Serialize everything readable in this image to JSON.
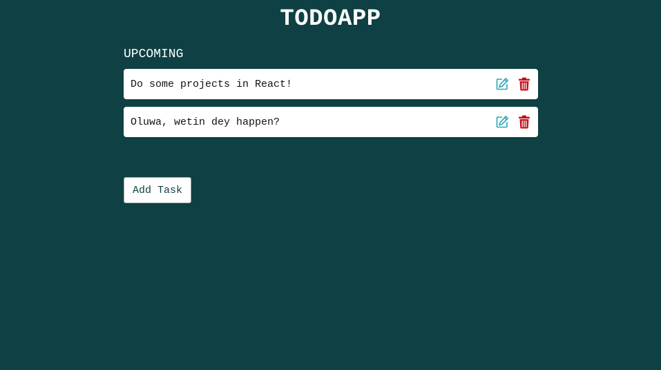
{
  "app": {
    "title": "TODOAPP"
  },
  "section": {
    "heading": "UPCOMING"
  },
  "tasks": [
    {
      "text": "Do some projects in React!",
      "edit_icon": "edit-icon",
      "delete_icon": "trash-icon"
    },
    {
      "text": "Oluwa, wetin dey happen?",
      "edit_icon": "edit-icon",
      "delete_icon": "trash-icon"
    }
  ],
  "actions": {
    "add_label": "Add Task"
  },
  "colors": {
    "background": "#0f4043",
    "card": "#ffffff",
    "edit_icon": "#2aa4b8",
    "delete_icon": "#c4101a"
  }
}
